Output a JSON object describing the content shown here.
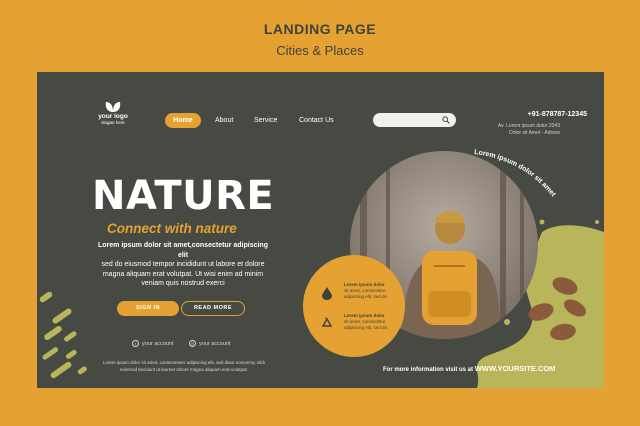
{
  "header": {
    "title": "LANDING PAGE",
    "subtitle": "Cities & Places"
  },
  "logo": {
    "name": "your logo",
    "slogan": "slogan here"
  },
  "nav": {
    "home": "Home",
    "about": "About",
    "service": "Service",
    "contact": "Contact Us"
  },
  "search": {
    "placeholder": ""
  },
  "contact": {
    "phone": "+91-878787-12345",
    "address_line1": "Av. Lorem ipsum dolor 2043",
    "address_line2": "Dolor sit Amet - Adress"
  },
  "hero": {
    "title": "NATURE",
    "subtitle": "Connect with nature",
    "body_bold": "Lorem ipsum dolor sit amet,consectetur adipiscing elit",
    "body_rest": "sed do eiusmod tempor incididunt ut labore et dolore magna aliquam erat volutpat. Ut wisi enim ad minim veniam quis nostrud exerci",
    "sign_in": "SIGN IN",
    "read_more": "READ MORE"
  },
  "social": {
    "facebook": "your account",
    "instagram": "your account"
  },
  "footer_text": "Lorem ipsum dolor sit amet, consectetuer adipiscing elit, sed diam nonummy nibh euismod tincidunt ut laoreet dolore magna aliquam erat volutpat.",
  "circle_text": "Lorem ipsum dolor sit amet",
  "info": [
    {
      "bold": "Lorem ipsum dolor",
      "text": "sit amet, consectetur adipiscing elit, sed do"
    },
    {
      "bold": "Lorem ipsum dolor",
      "text": "sit amet, consectetur adipiscing elit, sed do"
    }
  ],
  "more_info": {
    "label": "For more information visit us at",
    "url": "WWW.YOURSITE.COM"
  },
  "colors": {
    "background": "#e5a233",
    "card": "#474a43",
    "accent": "#e5a233",
    "lime": "#b8b55a"
  }
}
